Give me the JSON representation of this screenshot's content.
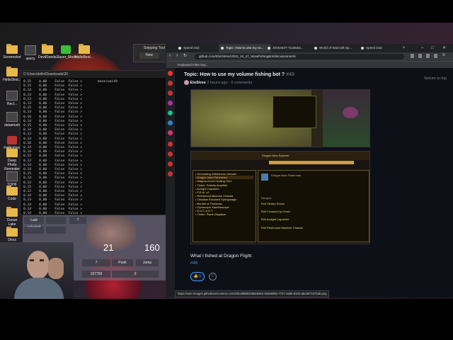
{
  "desktop": {
    "icons": [
      {
        "label": "Screenshot",
        "kind": "folder"
      },
      {
        "label": "upscy",
        "kind": "dark"
      },
      {
        "label": "DevilSeeds...",
        "kind": "folder"
      },
      {
        "label": "Razer_Mode...",
        "kind": "green"
      },
      {
        "label": "HelloBoot...",
        "kind": "folder"
      },
      {
        "label": "HelloShot...",
        "kind": "folder"
      },
      {
        "label": "Recl...",
        "kind": "dark"
      },
      {
        "label": "datamosh",
        "kind": "dark"
      },
      {
        "label": "FoOnstore",
        "kind": "red"
      },
      {
        "label": "Deep Photo Reminder",
        "kind": "folder"
      },
      {
        "label": "TOHF Deep",
        "kind": "dark"
      },
      {
        "label": "Code",
        "kind": "folder"
      },
      {
        "label": "Ocean Lake",
        "kind": "folder"
      },
      {
        "label": "Docs",
        "kind": "folder"
      }
    ]
  },
  "snipping": {
    "title": "Snipping Tool",
    "new_label": "New"
  },
  "terminal": {
    "tab_title": "C:\\Users\\tollo\\Downloads\\26",
    "lines": [
      "0,25    0,00 -  False  False >        move/wait0",
      "0,15    0,00 -  False  False >",
      "0,14    0,00 -  False  False >",
      "0,14    0,00 -  False  False >",
      "0,13    0,00 -  False  False >",
      "0,13    0,00 -  False  False >",
      "0,15    0,00 -  False  False >",
      "0,14    0,00 -  False  False >",
      "0,16    0,00 -  False  False >",
      "0,14    0,00 -  False  False >",
      "0,15    0,00 -  False  False >",
      "0,14    0,00 -  False  False >",
      "0,13    0,00 -  False  False >",
      "0,14    0,00 -  False  False >",
      "0,16    0,00 -  False  False >",
      "0,14    0,00 -  False  False >",
      "0,14    0,00 -  False  False >",
      "0,15    0,00 -  False  False >",
      "0,13    0,00 -  False  False >",
      "0,14    0,00 -  False  False >",
      "0,14    0,00 -  False  False >",
      "0,15    0,00 -  False  False >",
      "0,14    0,00 -  False  False >",
      "0,14    0,00 -  False  False >",
      "0,15    0,00 -  False  False >",
      "0,12    0,00 -  False  False >",
      "0,14    0,00 -  False  False >",
      "0,13    0,00 -  False  False >",
      "0,14    0,00 -  False  False >",
      "0,14    0,00 -  False  False >",
      "0,14    0,00 -  False  False >"
    ]
  },
  "calculator": {
    "display_left": "21",
    "display_right": "160",
    "value_a": "7",
    "value_b": "197750",
    "value_c": "0",
    "buttons": [
      "Last selected",
      "7",
      "Push",
      "Jump"
    ]
  },
  "browser": {
    "tabs": [
      {
        "label": "Speed Dial"
      },
      {
        "label": "Topic: How to use my vo..."
      },
      {
        "label": "2005402T-71ab8b4..."
      },
      {
        "label": "World of Warcraft Sp..."
      },
      {
        "label": "Speed Dial"
      }
    ],
    "url": "github.com/Elo0Stree/2020_10_27_WowFishingBot/discussions/49",
    "bookmark": "Keyboard Filter key...",
    "page": {
      "topic_title": "Topic: How to use my volume fishing bot ?",
      "topic_number": "#49",
      "author": "EloStree",
      "time": "2 hours ago",
      "comments": "0 comments",
      "return_top": "Return to top",
      "caption": "What I fished at Dragon Flight:",
      "tag": "#46",
      "reaction_count": "1",
      "status_url": "https://user-images.githubusercontent.com/20519898/209655962-93a59992-7707-4665-9334-abc8871576ab.png"
    },
    "wow": {
      "title": "Dragon Isles Explorer",
      "list_header": "Recipes",
      "item_title": "Dragon Isles Fisherman",
      "list": [
        "Decorating Wilderness Utensils",
        "Dragon Isles Fisherman",
        "Magma-cured Healing Gem",
        "Tinker: Polarity Amplifier",
        "Arclight Capacitor",
        "P.E.W. x2",
        "Reinforced Machine Chassis",
        "Obsidian Encased Springmagic",
        "Bundle of Fireworks",
        "Gyroscopic Kaleidoscope",
        "D.U.C.A.D.T.",
        "Tinker: Plane Displacer"
      ],
      "rewards": [
        "Roll Vibrant Rocks",
        "Roll Crossed Up Crush",
        "Roll Arclight Capacitor",
        "Roll Reinforced Machine Chassis"
      ]
    }
  }
}
